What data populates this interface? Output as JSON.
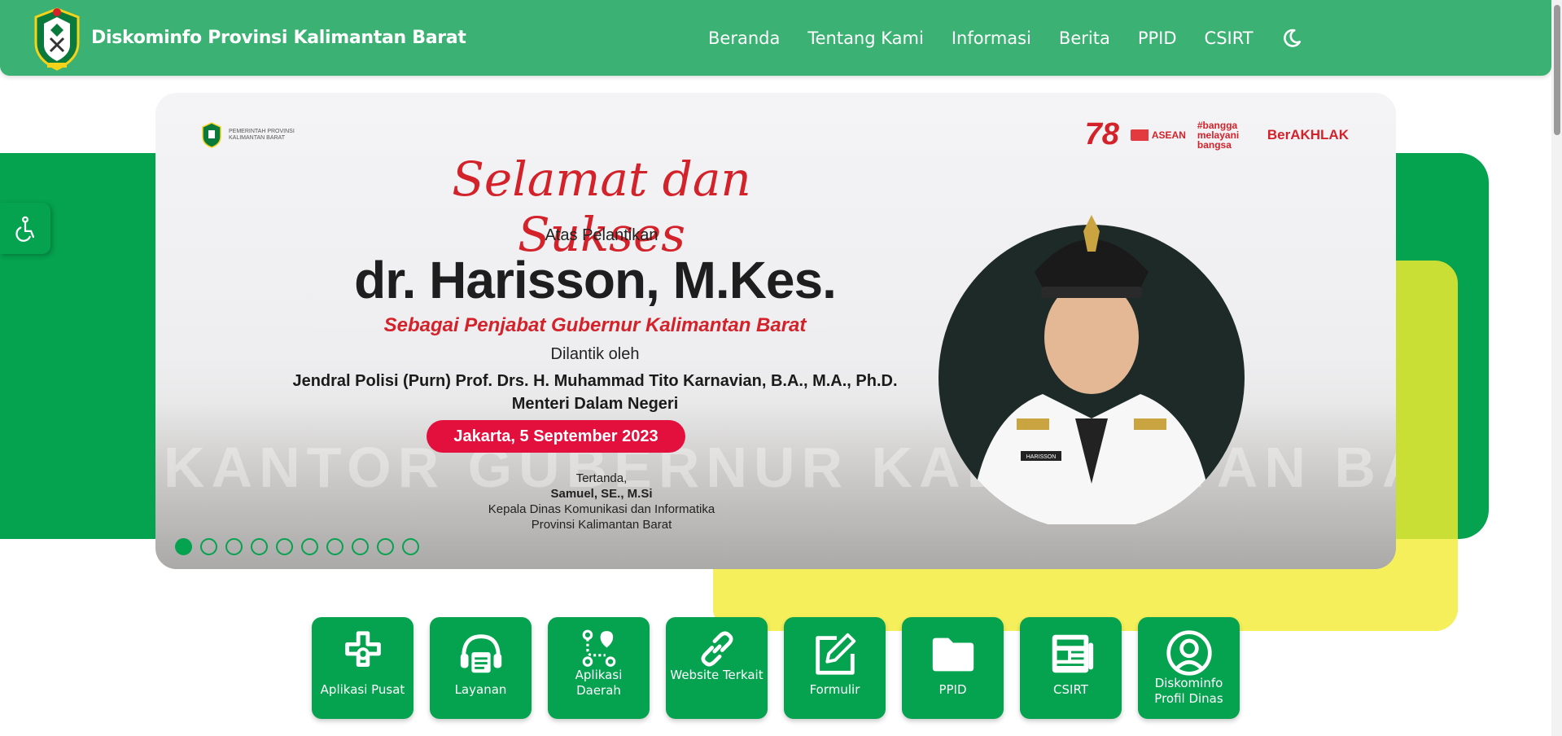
{
  "header": {
    "brand_title": "Diskominfo Provinsi Kalimantan Barat",
    "nav": [
      "Beranda",
      "Tentang Kami",
      "Informasi",
      "Berita",
      "PPID",
      "CSIRT"
    ]
  },
  "banner": {
    "gov_label_line1": "PEMERINTAH PROVINSI",
    "gov_label_line2": "KALIMANTAN BARAT",
    "partners": [
      "78",
      "ASEAN",
      "#bangga melayani bangsa",
      "BerAKHLAK"
    ],
    "script_title": "Selamat dan Sukses",
    "subtitle": "Atas Pelantikan",
    "name": "dr. Harisson, M.Kes.",
    "role": "Sebagai Penjabat Gubernur Kalimantan Barat",
    "inaugurated_by": "Dilantik oleh",
    "minister_line1": "Jendral Polisi (Purn) Prof. Drs. H. Muhammad Tito Karnavian, B.A., M.A., Ph.D.",
    "minister_line2": "Menteri Dalam Negeri",
    "date": "Jakarta, 5 September 2023",
    "signed": "Tertanda,",
    "signer": "Samuel, SE., M.Si",
    "signer_title": "Kepala Dinas Komunikasi dan Informatika",
    "signer_region": "Provinsi Kalimantan Barat",
    "bg_text": "KANTOR GUBERNUR KALIMANTAN BARAT",
    "name_tag": "HARISSON",
    "slide_count": 10,
    "active_slide": 1
  },
  "quick_links": [
    {
      "label": "Aplikasi Pusat",
      "icon": "puzzle-icon"
    },
    {
      "label": "Layanan",
      "icon": "service-icon"
    },
    {
      "label": "Aplikasi Daerah",
      "icon": "route-icon"
    },
    {
      "label": "Website Terkait",
      "icon": "link-icon"
    },
    {
      "label": "Formulir",
      "icon": "edit-icon"
    },
    {
      "label": "PPID",
      "icon": "folder-icon"
    },
    {
      "label": "CSIRT",
      "icon": "newspaper-icon"
    },
    {
      "label": "Diskominfo Profil Dinas",
      "icon": "user-circle-icon"
    }
  ],
  "colors": {
    "header": "#3bb273",
    "primary_green": "#05a24f",
    "lime": "#c9df36",
    "yellow": "#f4ef5b",
    "accent_red": "#d3222a"
  }
}
